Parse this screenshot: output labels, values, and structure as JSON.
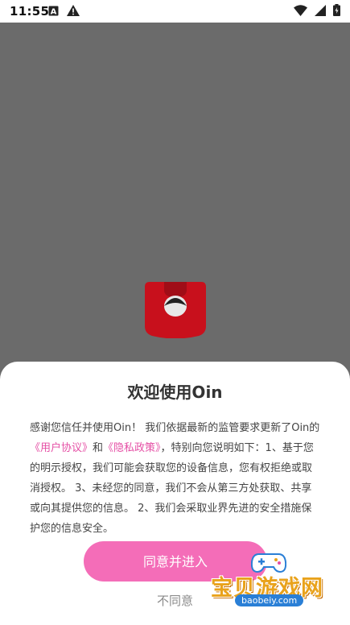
{
  "status_bar": {
    "time": "11:55",
    "icons": [
      "notification-a-icon",
      "warning-icon",
      "wifi-icon",
      "signal-icon",
      "battery-icon"
    ]
  },
  "dialog": {
    "title": "欢迎使用Oin",
    "body_part1": "感谢您信任并使用Oin！ 我们依据最新的监管要求更新了Oin的",
    "link_user_agreement": "《用户协议》",
    "body_and": "和",
    "link_privacy_policy": "《隐私政策》",
    "body_part2": "，特别向您说明如下：1、基于您的明示授权，我们可能会获取您的设备信息，您有权拒绝或取消授权。 3、未经您的同意，我们不会从第三方处获取、共享或向其提供您的信息。 2、我们会采取业界先进的安全措施保护您的信息安全。",
    "agree_label": "同意并进入",
    "disagree_label": "不同意"
  },
  "watermark": {
    "title": "宝贝游戏网",
    "url": "baobeiy.com"
  },
  "colors": {
    "overlay": "#6b6b6b",
    "accent_pink": "#f46db8",
    "link_pink": "#e54fa5",
    "logo_red": "#c8101c"
  }
}
